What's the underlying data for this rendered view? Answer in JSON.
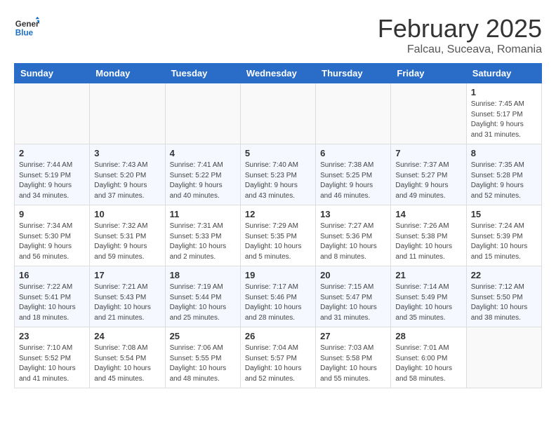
{
  "header": {
    "logo_general": "General",
    "logo_blue": "Blue",
    "month_title": "February 2025",
    "subtitle": "Falcau, Suceava, Romania"
  },
  "weekdays": [
    "Sunday",
    "Monday",
    "Tuesday",
    "Wednesday",
    "Thursday",
    "Friday",
    "Saturday"
  ],
  "weeks": [
    [
      {
        "day": "",
        "info": ""
      },
      {
        "day": "",
        "info": ""
      },
      {
        "day": "",
        "info": ""
      },
      {
        "day": "",
        "info": ""
      },
      {
        "day": "",
        "info": ""
      },
      {
        "day": "",
        "info": ""
      },
      {
        "day": "1",
        "info": "Sunrise: 7:45 AM\nSunset: 5:17 PM\nDaylight: 9 hours and 31 minutes."
      }
    ],
    [
      {
        "day": "2",
        "info": "Sunrise: 7:44 AM\nSunset: 5:19 PM\nDaylight: 9 hours and 34 minutes."
      },
      {
        "day": "3",
        "info": "Sunrise: 7:43 AM\nSunset: 5:20 PM\nDaylight: 9 hours and 37 minutes."
      },
      {
        "day": "4",
        "info": "Sunrise: 7:41 AM\nSunset: 5:22 PM\nDaylight: 9 hours and 40 minutes."
      },
      {
        "day": "5",
        "info": "Sunrise: 7:40 AM\nSunset: 5:23 PM\nDaylight: 9 hours and 43 minutes."
      },
      {
        "day": "6",
        "info": "Sunrise: 7:38 AM\nSunset: 5:25 PM\nDaylight: 9 hours and 46 minutes."
      },
      {
        "day": "7",
        "info": "Sunrise: 7:37 AM\nSunset: 5:27 PM\nDaylight: 9 hours and 49 minutes."
      },
      {
        "day": "8",
        "info": "Sunrise: 7:35 AM\nSunset: 5:28 PM\nDaylight: 9 hours and 52 minutes."
      }
    ],
    [
      {
        "day": "9",
        "info": "Sunrise: 7:34 AM\nSunset: 5:30 PM\nDaylight: 9 hours and 56 minutes."
      },
      {
        "day": "10",
        "info": "Sunrise: 7:32 AM\nSunset: 5:31 PM\nDaylight: 9 hours and 59 minutes."
      },
      {
        "day": "11",
        "info": "Sunrise: 7:31 AM\nSunset: 5:33 PM\nDaylight: 10 hours and 2 minutes."
      },
      {
        "day": "12",
        "info": "Sunrise: 7:29 AM\nSunset: 5:35 PM\nDaylight: 10 hours and 5 minutes."
      },
      {
        "day": "13",
        "info": "Sunrise: 7:27 AM\nSunset: 5:36 PM\nDaylight: 10 hours and 8 minutes."
      },
      {
        "day": "14",
        "info": "Sunrise: 7:26 AM\nSunset: 5:38 PM\nDaylight: 10 hours and 11 minutes."
      },
      {
        "day": "15",
        "info": "Sunrise: 7:24 AM\nSunset: 5:39 PM\nDaylight: 10 hours and 15 minutes."
      }
    ],
    [
      {
        "day": "16",
        "info": "Sunrise: 7:22 AM\nSunset: 5:41 PM\nDaylight: 10 hours and 18 minutes."
      },
      {
        "day": "17",
        "info": "Sunrise: 7:21 AM\nSunset: 5:43 PM\nDaylight: 10 hours and 21 minutes."
      },
      {
        "day": "18",
        "info": "Sunrise: 7:19 AM\nSunset: 5:44 PM\nDaylight: 10 hours and 25 minutes."
      },
      {
        "day": "19",
        "info": "Sunrise: 7:17 AM\nSunset: 5:46 PM\nDaylight: 10 hours and 28 minutes."
      },
      {
        "day": "20",
        "info": "Sunrise: 7:15 AM\nSunset: 5:47 PM\nDaylight: 10 hours and 31 minutes."
      },
      {
        "day": "21",
        "info": "Sunrise: 7:14 AM\nSunset: 5:49 PM\nDaylight: 10 hours and 35 minutes."
      },
      {
        "day": "22",
        "info": "Sunrise: 7:12 AM\nSunset: 5:50 PM\nDaylight: 10 hours and 38 minutes."
      }
    ],
    [
      {
        "day": "23",
        "info": "Sunrise: 7:10 AM\nSunset: 5:52 PM\nDaylight: 10 hours and 41 minutes."
      },
      {
        "day": "24",
        "info": "Sunrise: 7:08 AM\nSunset: 5:54 PM\nDaylight: 10 hours and 45 minutes."
      },
      {
        "day": "25",
        "info": "Sunrise: 7:06 AM\nSunset: 5:55 PM\nDaylight: 10 hours and 48 minutes."
      },
      {
        "day": "26",
        "info": "Sunrise: 7:04 AM\nSunset: 5:57 PM\nDaylight: 10 hours and 52 minutes."
      },
      {
        "day": "27",
        "info": "Sunrise: 7:03 AM\nSunset: 5:58 PM\nDaylight: 10 hours and 55 minutes."
      },
      {
        "day": "28",
        "info": "Sunrise: 7:01 AM\nSunset: 6:00 PM\nDaylight: 10 hours and 58 minutes."
      },
      {
        "day": "",
        "info": ""
      }
    ]
  ]
}
